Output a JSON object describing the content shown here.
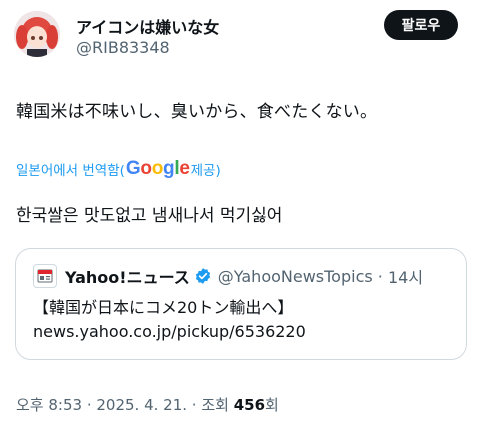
{
  "author": {
    "display_name": "アイコンは嫌いな女",
    "handle": "@RIB83348"
  },
  "follow_button": {
    "label": "팔로우"
  },
  "tweet": {
    "text": "韓国米は不味いし、臭いから、食べたくない。",
    "translate_prefix": "일본어에서 번역함(",
    "translate_brand": "Google",
    "translate_suffix": " 제공)",
    "translated_text": "한국쌀은 맛도없고 냄새나서 먹기싫어"
  },
  "quote": {
    "name": "Yahoo!ニュース",
    "handle": "@YahooNewsTopics",
    "separator": " · ",
    "time": "14시",
    "line1": "【韓国が日本にコメ20トン輸出へ】",
    "line2": "news.yahoo.co.jp/pickup/6536220"
  },
  "meta": {
    "time": "오후 8:53",
    "separator": " · ",
    "date": "2025. 4. 21.",
    "views_label": "조회 ",
    "views_count": "456",
    "views_unit": "회"
  },
  "icons": {
    "avatar": "anime-girl-avatar",
    "verified": "verified-badge-icon",
    "yahoo": "yahoo-news-icon"
  },
  "colors": {
    "text": "#0f1419",
    "secondary": "#536471",
    "link": "#1d9bf0",
    "verified": "#1d9bf0",
    "border": "#cfd9de",
    "google_blue": "#4285F4",
    "google_red": "#EA4335",
    "google_yellow": "#FBBC05",
    "google_green": "#34A853"
  }
}
